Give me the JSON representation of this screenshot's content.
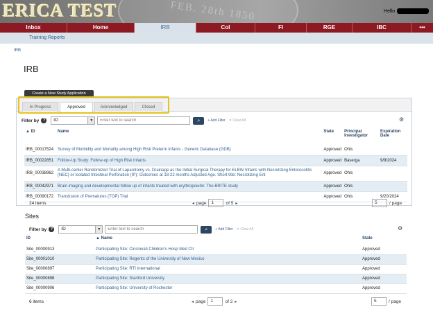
{
  "header": {
    "logo": "ERICA TEST",
    "seal_text": "FEB. 28th 1850",
    "greeting": "Hello"
  },
  "nav": {
    "items": [
      {
        "label": "Inbox"
      },
      {
        "label": "Home"
      },
      {
        "label": "IRB",
        "active": true
      },
      {
        "label": "CoI"
      },
      {
        "label": "FI"
      },
      {
        "label": "RGE"
      },
      {
        "label": "IBC"
      },
      {
        "label": "•••"
      }
    ],
    "sub_link": "Training Reports"
  },
  "breadcrumb": "IRB",
  "page_title": "IRB",
  "create_button": "Create a New Study Application",
  "tabs": [
    "In Progress",
    "Approved",
    "Acknowledged",
    "Closed"
  ],
  "study_filter": {
    "label": "Filter by",
    "field": "ID",
    "placeholder": "Enter text to search",
    "add_filter": "Add Filter",
    "clear_all": "Clear All"
  },
  "studies": {
    "columns": [
      "ID",
      "Name",
      "State",
      "Principal Investigator",
      "Expiration Date"
    ],
    "rows": [
      {
        "id": "IRB_00017524",
        "name": "Survey of Morbidity and Mortality among High Risk Preterm Infants - Generic Database (GDB)",
        "state": "Approved",
        "pi": "Ohls",
        "exp": ""
      },
      {
        "id": "IRB_00022851",
        "name": "Follow-Up Study: Follow-up of High Risk Infants",
        "state": "Approved",
        "pi": "Baserga",
        "exp": "9/9/2024"
      },
      {
        "id": "IRB_00038962",
        "name": "A Multi-center Randomized Trial of Laparotomy vs. Drainage as the Initial Surgical Therapy for ELBW Infants with Necrotizing Enterocolitis (NEC) or Isolated Intestinal Perforation (IP): Outcomes at 18-22 months Adjusted Age. Short title: Necrotizing Ent",
        "state": "Approved",
        "pi": "Ohls",
        "exp": ""
      },
      {
        "id": "IRB_00042971",
        "name": "Brain imaging and developmental follow up of infants treated with erythropoietin: The BRITE study",
        "state": "Approved",
        "pi": "Ohls",
        "exp": ""
      },
      {
        "id": "IRB_00090172",
        "name": "Transfusion of Prematures (TOP) Trial",
        "state": "Approved",
        "pi": "Ohls",
        "exp": "9/20/2024"
      }
    ],
    "item_count": "24 items",
    "page_label": "page",
    "page": "1",
    "of_pages": "of 5",
    "page_size": "5",
    "page_size_label": "/ page"
  },
  "sites_title": "Sites",
  "site_filter": {
    "label": "Filter by",
    "field": "ID",
    "placeholder": "Enter text to search",
    "add_filter": "Add Filter",
    "clear_all": "Clear All"
  },
  "sites": {
    "columns": [
      "ID",
      "Name",
      "State"
    ],
    "rows": [
      {
        "id": "Site_00000913",
        "name": "Participating Site: Cincinnati Children's Hosp Med Ctr",
        "state": "Approved"
      },
      {
        "id": "Site_00001010",
        "name": "Participating Site: Regents of the University of New Mexico",
        "state": "Approved"
      },
      {
        "id": "Site_00000897",
        "name": "Participating Site: RTI International",
        "state": "Approved"
      },
      {
        "id": "Site_00000898",
        "name": "Participating Site: Stanford University",
        "state": "Approved"
      },
      {
        "id": "Site_00000906",
        "name": "Participating Site: University of Rochester",
        "state": "Approved"
      }
    ],
    "item_count": "6 items",
    "page_label": "page",
    "page": "1",
    "of_pages": "of 2",
    "page_size": "5",
    "page_size_label": "/ page"
  },
  "colors": {
    "nav": "#8d1a22",
    "highlight": "#e7c21a",
    "link": "#2f5f8f"
  }
}
